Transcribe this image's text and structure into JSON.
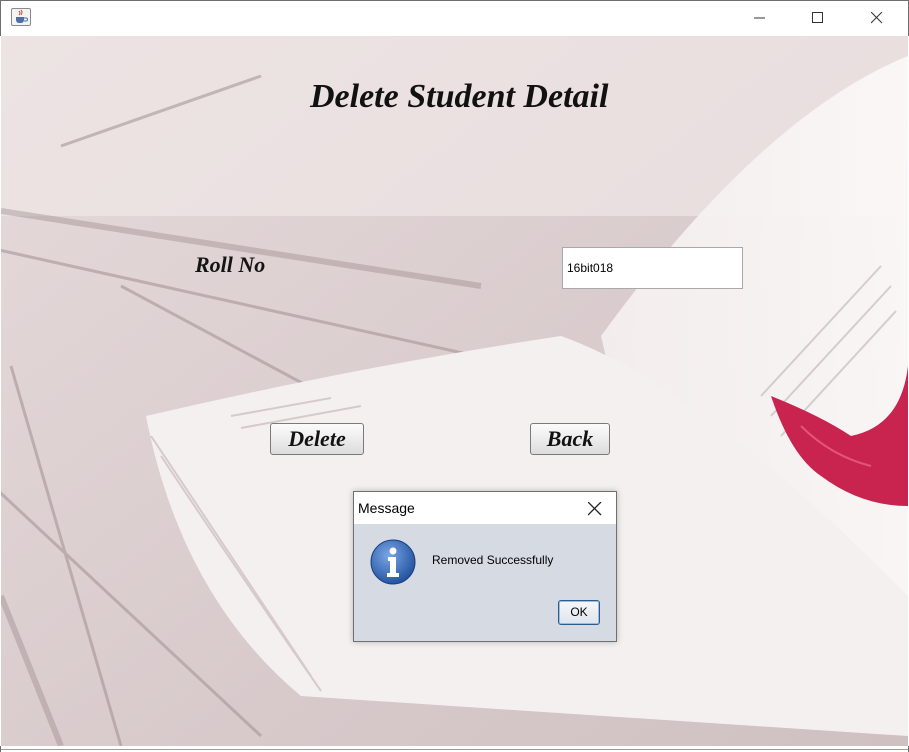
{
  "window": {
    "app_icon": "java-cup-icon",
    "controls": [
      "minimize-icon",
      "maximize-icon",
      "close-icon"
    ]
  },
  "form": {
    "title": "Delete Student Detail",
    "roll_label": "Roll No",
    "roll_value": "16bit018",
    "delete_label": "Delete",
    "back_label": "Back"
  },
  "dialog": {
    "title": "Message",
    "message": "Removed Successfully",
    "ok_label": "OK",
    "icon": "info-icon"
  },
  "colors": {
    "accent_blue": "#2f5fae",
    "petal_red": "#c8244f",
    "dialog_bg": "#d6dae3"
  }
}
